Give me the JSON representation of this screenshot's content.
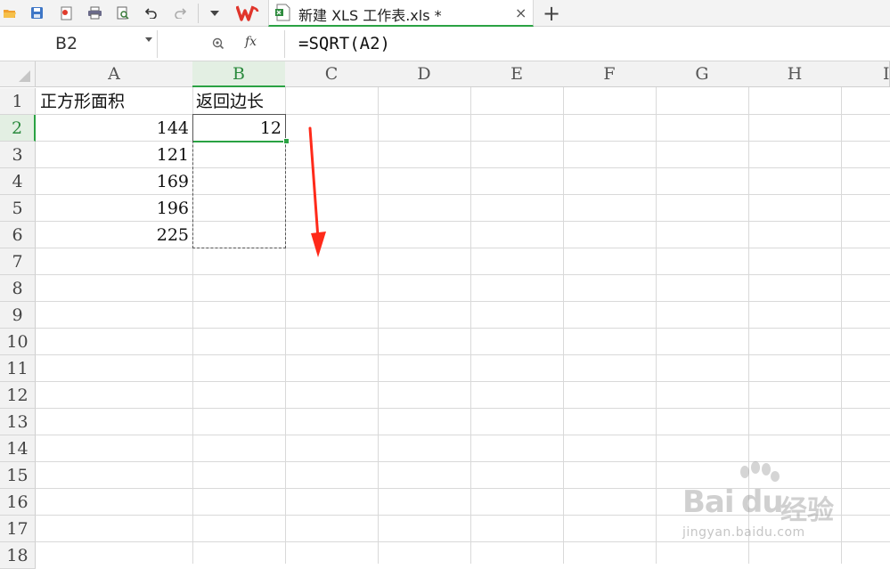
{
  "toolbar": {
    "quick_access": [
      "open-folder-icon",
      "save-icon",
      "export-pdf-icon",
      "print-icon",
      "print-preview-icon",
      "undo-icon",
      "redo-icon",
      "more-dropdown-icon",
      "wps-logo-icon"
    ],
    "document_tab": {
      "title": "新建 XLS 工作表.xls *",
      "close_label": "×"
    },
    "new_tab_label": "+"
  },
  "formula_bar": {
    "name_box": "B2",
    "fx_label": "fx",
    "formula": "=SQRT(A2)"
  },
  "grid": {
    "columns": [
      "A",
      "B",
      "C",
      "D",
      "E",
      "F",
      "G",
      "H",
      "I"
    ],
    "rows": [
      "1",
      "2",
      "3",
      "4",
      "5",
      "6",
      "7",
      "8",
      "9",
      "10",
      "11",
      "12",
      "13",
      "14",
      "15",
      "16",
      "17",
      "18"
    ],
    "selected_column": "B",
    "selected_row": "2",
    "cells": {
      "A1": "正方形面积",
      "B1": "返回边长",
      "A2": "144",
      "B2": "12",
      "A3": "121",
      "A4": "169",
      "A5": "196",
      "A6": "225"
    }
  },
  "annotation": {
    "arrow_color": "#ff2a1a"
  },
  "colors": {
    "accent": "#2aa243",
    "header_bg": "#f2f2f2",
    "wps_red": "#e0352b"
  },
  "watermark": {
    "brand": "Bai",
    "brand_du": "du",
    "brand_cn": "经验",
    "url": "jingyan.baidu.com"
  }
}
